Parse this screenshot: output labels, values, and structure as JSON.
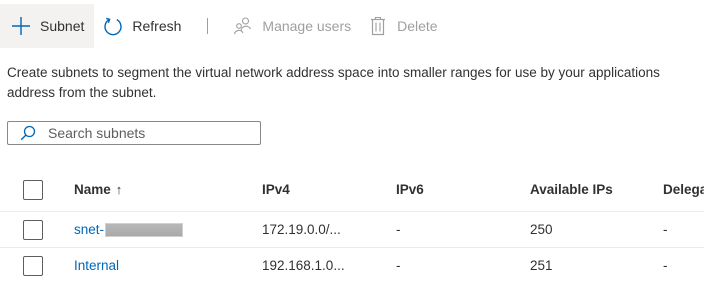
{
  "toolbar": {
    "add_subnet_label": "Subnet",
    "refresh_label": "Refresh",
    "manage_users_label": "Manage users",
    "delete_label": "Delete",
    "icons": {
      "add": "plus-icon",
      "refresh": "refresh-icon",
      "manage_users": "people-icon",
      "delete": "trash-icon"
    }
  },
  "description": {
    "line1": "Create subnets to segment the virtual network address space into smaller ranges for use by your applications",
    "line2": "address from the subnet."
  },
  "search": {
    "placeholder": "Search subnets",
    "value": ""
  },
  "table": {
    "headers": {
      "name": "Name",
      "name_sort": "↑",
      "ipv4": "IPv4",
      "ipv6": "IPv6",
      "available_ips": "Available IPs",
      "delegated": "Delega"
    },
    "rows": [
      {
        "name": "snet-",
        "name_redacted": true,
        "ipv4": "172.19.0.0/...",
        "ipv6": "-",
        "available_ips": "250",
        "delegated": "-"
      },
      {
        "name": "Internal",
        "name_redacted": false,
        "ipv4": "192.168.1.0...",
        "ipv6": "-",
        "available_ips": "251",
        "delegated": "-"
      }
    ]
  },
  "colors": {
    "accent": "#0067b8",
    "disabled": "#a19f9d",
    "text": "#323130"
  }
}
